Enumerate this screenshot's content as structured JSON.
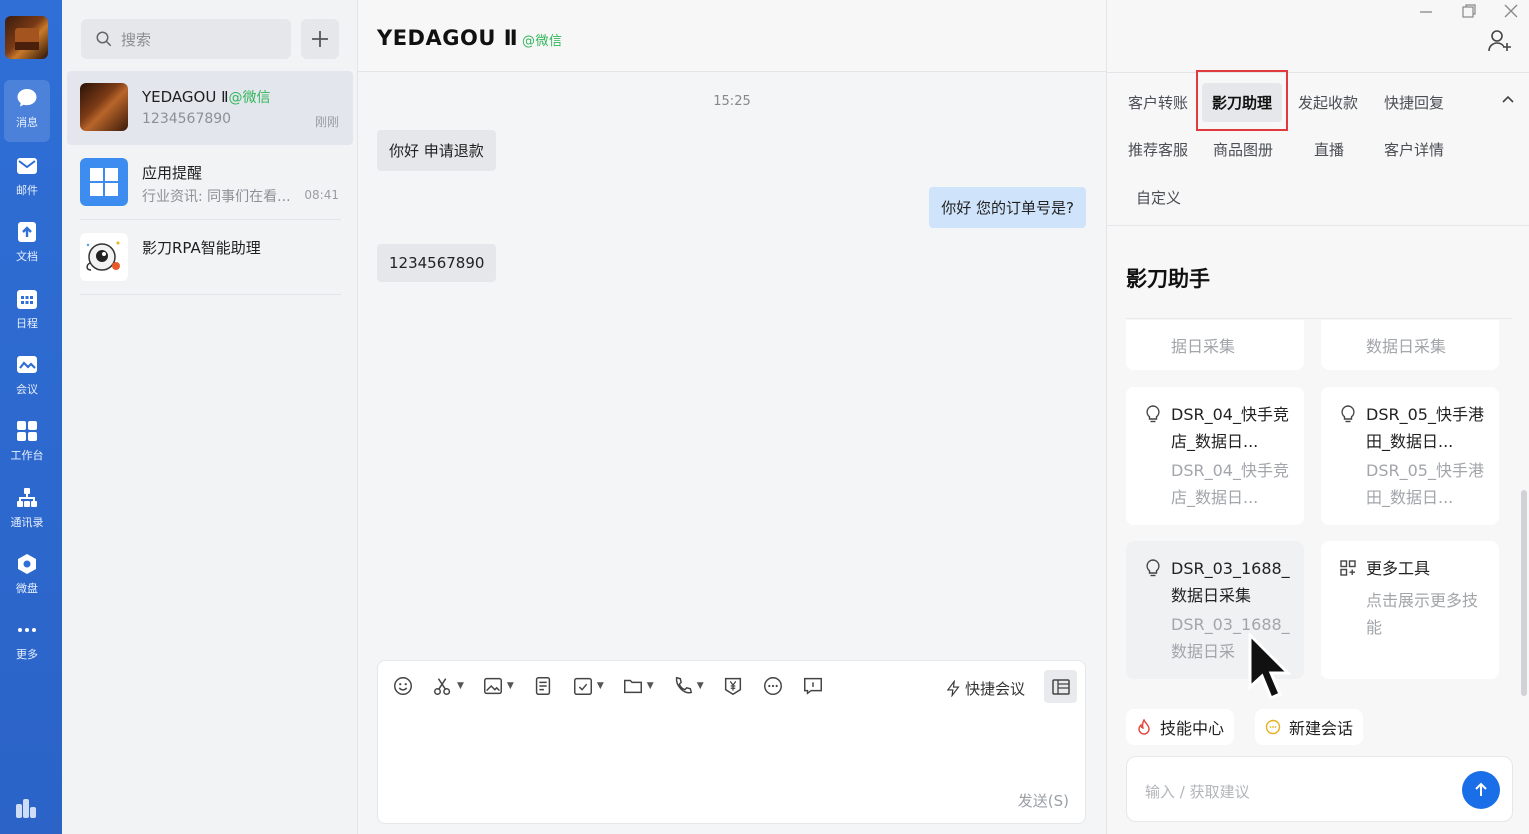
{
  "rail": {
    "items": [
      {
        "label": "消息",
        "icon": "chat-bubble-icon"
      },
      {
        "label": "邮件",
        "icon": "mail-icon"
      },
      {
        "label": "文档",
        "icon": "document-icon"
      },
      {
        "label": "日程",
        "icon": "calendar-icon"
      },
      {
        "label": "会议",
        "icon": "meeting-icon"
      },
      {
        "label": "工作台",
        "icon": "grid-icon"
      },
      {
        "label": "通讯录",
        "icon": "org-chart-icon"
      },
      {
        "label": "微盘",
        "icon": "cloud-drive-icon"
      },
      {
        "label": "更多",
        "icon": "more-icon"
      }
    ]
  },
  "conversations": {
    "search_placeholder": "搜索",
    "items": [
      {
        "name": "YEDAGOU Ⅱ",
        "tag": "@微信",
        "sub": "1234567890",
        "time": "刚刚"
      },
      {
        "name": "应用提醒",
        "tag": "",
        "sub": "行业资讯: 同事们在看...",
        "time": "08:41"
      },
      {
        "name": "影刀RPA智能助理",
        "tag": "",
        "sub": "",
        "time": ""
      }
    ]
  },
  "chat": {
    "title": "YEDAGOU Ⅱ",
    "title_tag": "@微信",
    "time_divider": "15:25",
    "messages": [
      {
        "text": "你好 申请退款",
        "from": "them"
      },
      {
        "text": "你好 您的订单号是?",
        "from": "me"
      },
      {
        "text": "1234567890",
        "from": "them"
      }
    ],
    "quick_meeting": "快捷会议",
    "send_label": "发送(S)"
  },
  "panel": {
    "tabs_row1": [
      "客户转账",
      "影刀助理",
      "发起收款",
      "快捷回复"
    ],
    "tabs_row2": [
      "推荐客服",
      "商品图册",
      "直播",
      "客户详情"
    ],
    "tabs_row3": [
      "自定义"
    ],
    "active_tab": "影刀助理",
    "title": "影刀助手",
    "cut_cards": [
      "据日采集",
      "数据日采集"
    ],
    "cards": [
      {
        "title": "DSR_04_快手竞店_数据日...",
        "desc": "DSR_04_快手竞店_数据日..."
      },
      {
        "title": "DSR_05_快手港田_数据日...",
        "desc": "DSR_05_快手港田_数据日..."
      },
      {
        "title": "DSR_03_1688_数据日采集",
        "desc": "DSR_03_1688_数据日采"
      },
      {
        "title": "更多工具",
        "desc": "点击展示更多技能"
      }
    ],
    "chips": [
      "技能中心",
      "新建会话"
    ],
    "input_placeholder": "输入 / 获取建议"
  },
  "colors": {
    "rail": "#2f6fd6",
    "wechat_green": "#32b65a",
    "highlight_red": "#e0393e",
    "send_blue": "#1a6fe8"
  }
}
